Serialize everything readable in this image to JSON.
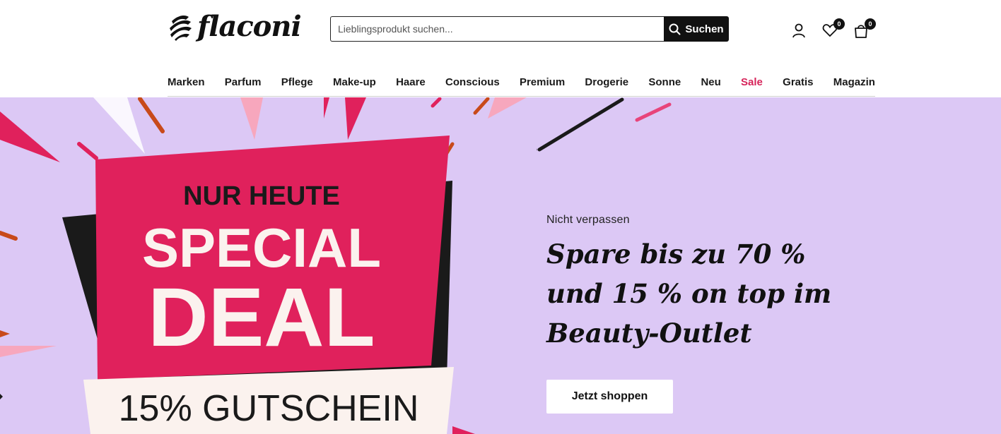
{
  "brand": {
    "name": "flaconi"
  },
  "search": {
    "placeholder": "Lieblingsprodukt suchen...",
    "button_label": "Suchen"
  },
  "header_icons": {
    "account": "user-icon",
    "wishlist": "heart-icon",
    "wishlist_count": "0",
    "cart": "bag-icon",
    "cart_count": "0"
  },
  "nav": {
    "items": [
      {
        "label": "Marken"
      },
      {
        "label": "Parfum"
      },
      {
        "label": "Pflege"
      },
      {
        "label": "Make-up"
      },
      {
        "label": "Haare"
      },
      {
        "label": "Conscious"
      },
      {
        "label": "Premium"
      },
      {
        "label": "Drogerie"
      },
      {
        "label": "Sonne"
      },
      {
        "label": "Neu"
      },
      {
        "label": "Sale"
      },
      {
        "label": "Gratis"
      },
      {
        "label": "Magazin"
      }
    ]
  },
  "hero": {
    "badge_line1": "NUR HEUTE",
    "badge_line2": "SPECIAL",
    "badge_line3": "DEAL",
    "voucher": "15% GUTSCHEIN",
    "eyebrow": "Nicht verpassen",
    "headline_line1": "Spare bis zu 70 %",
    "headline_line2": "und 15 % on top im",
    "headline_line3": "Beauty-Outlet",
    "cta_label": "Jetzt shoppen"
  },
  "colors": {
    "hero_background": "#dcc8f5",
    "badge_pink": "#e0215c",
    "sale_link": "#d6245a",
    "dark": "#1a1a1a",
    "voucher_bg": "#fbf2ee"
  }
}
